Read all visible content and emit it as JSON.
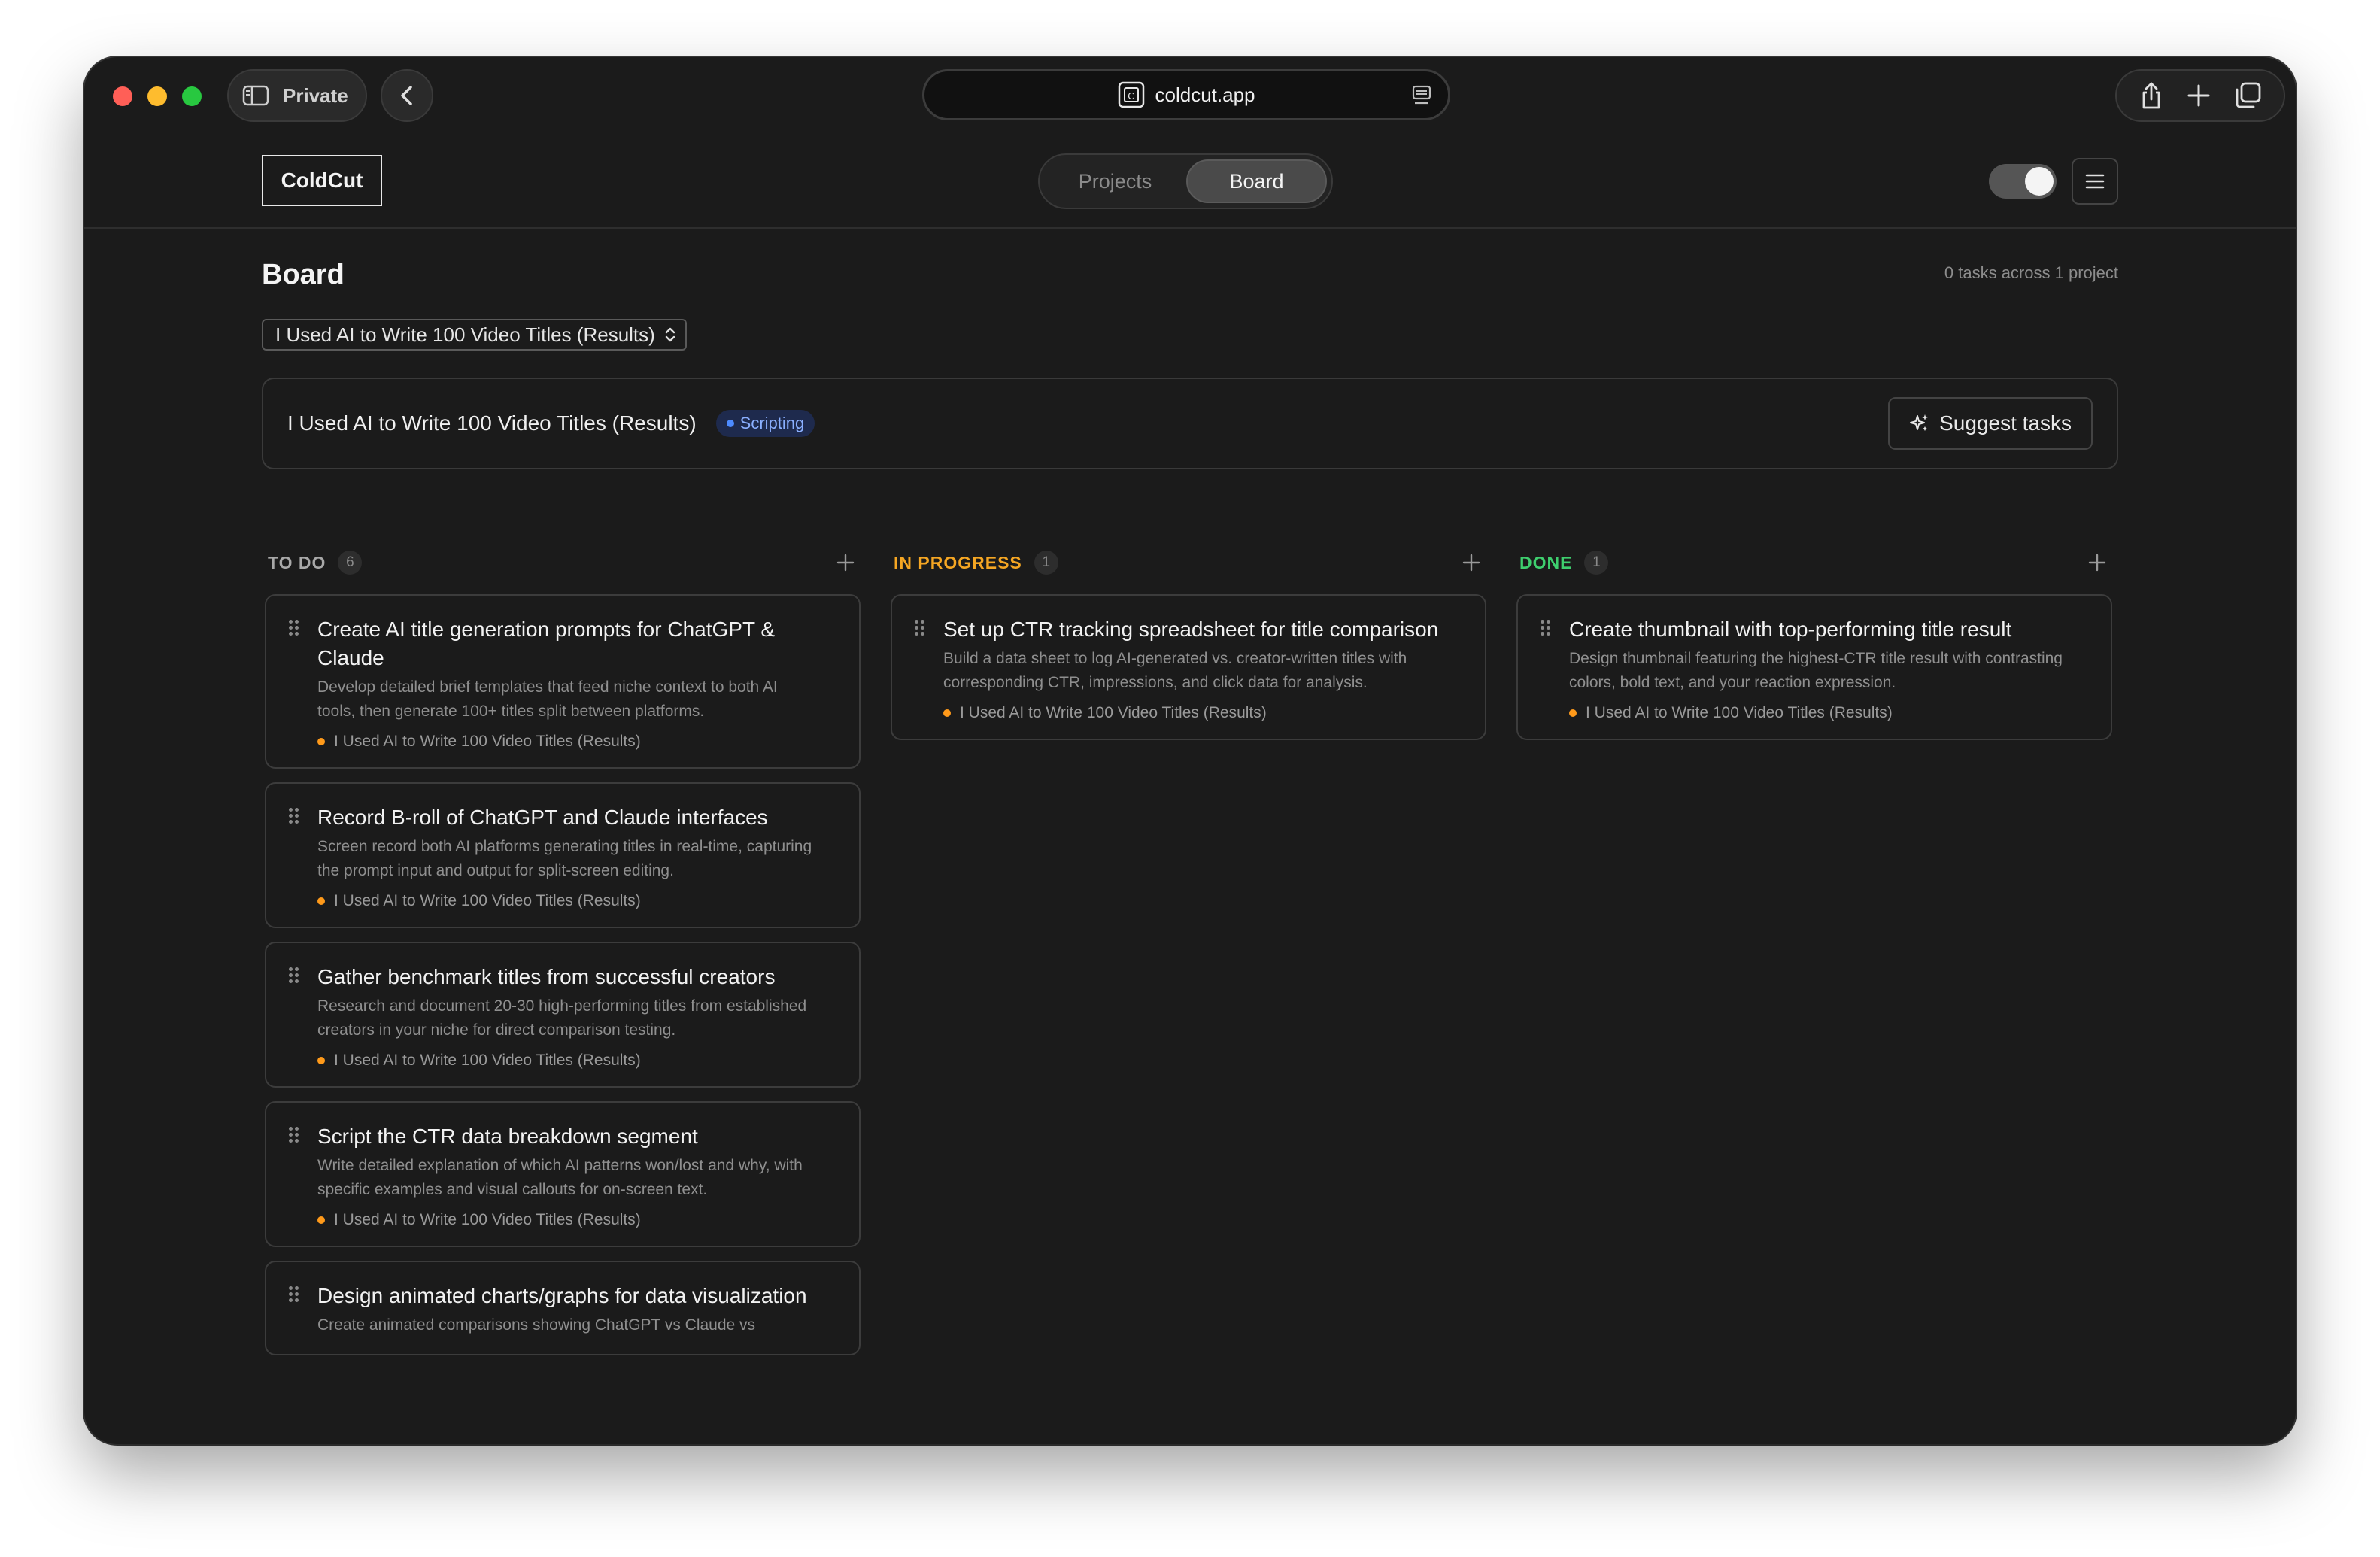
{
  "browser": {
    "private_label": "Private",
    "url": "coldcut.app"
  },
  "header": {
    "logo": "ColdCut",
    "nav": {
      "projects": "Projects",
      "board": "Board"
    }
  },
  "page": {
    "title": "Board",
    "summary": "0 tasks across 1 project",
    "project_select": "I Used AI to Write 100 Video Titles (Results)",
    "project_name": "I Used AI to Write 100 Video Titles (Results)",
    "project_stage": "Scripting",
    "suggest_label": "Suggest tasks"
  },
  "colors": {
    "todo": "#a8a8a8",
    "in_progress": "#f5a623",
    "done": "#3ecf6e",
    "accent_blue": "#4d8bff",
    "project_dot": "#ff9a1a"
  },
  "columns": {
    "todo": {
      "title": "TO DO",
      "count": "6",
      "cards": [
        {
          "title": "Create AI title generation prompts for ChatGPT & Claude",
          "desc": "Develop detailed brief templates that feed niche context to both AI tools, then generate 100+ titles split between platforms.",
          "project": "I Used AI to Write 100 Video Titles (Results)"
        },
        {
          "title": "Record B-roll of ChatGPT and Claude interfaces",
          "desc": "Screen record both AI platforms generating titles in real-time, capturing the prompt input and output for split-screen editing.",
          "project": "I Used AI to Write 100 Video Titles (Results)"
        },
        {
          "title": "Gather benchmark titles from successful creators",
          "desc": "Research and document 20-30 high-performing titles from established creators in your niche for direct comparison testing.",
          "project": "I Used AI to Write 100 Video Titles (Results)"
        },
        {
          "title": "Script the CTR data breakdown segment",
          "desc": "Write detailed explanation of which AI patterns won/lost and why, with specific examples and visual callouts for on-screen text.",
          "project": "I Used AI to Write 100 Video Titles (Results)"
        },
        {
          "title": "Design animated charts/graphs for data visualization",
          "desc": "Create animated comparisons showing ChatGPT vs Claude vs",
          "project": ""
        }
      ]
    },
    "in_progress": {
      "title": "IN PROGRESS",
      "count": "1",
      "cards": [
        {
          "title": "Set up CTR tracking spreadsheet for title comparison",
          "desc": "Build a data sheet to log AI-generated vs. creator-written titles with corresponding CTR, impressions, and click data for analysis.",
          "project": "I Used AI to Write 100 Video Titles (Results)"
        }
      ]
    },
    "done": {
      "title": "DONE",
      "count": "1",
      "cards": [
        {
          "title": "Create thumbnail with top-performing title result",
          "desc": "Design thumbnail featuring the highest-CTR title result with contrasting colors, bold text, and your reaction expression.",
          "project": "I Used AI to Write 100 Video Titles (Results)"
        }
      ]
    }
  }
}
